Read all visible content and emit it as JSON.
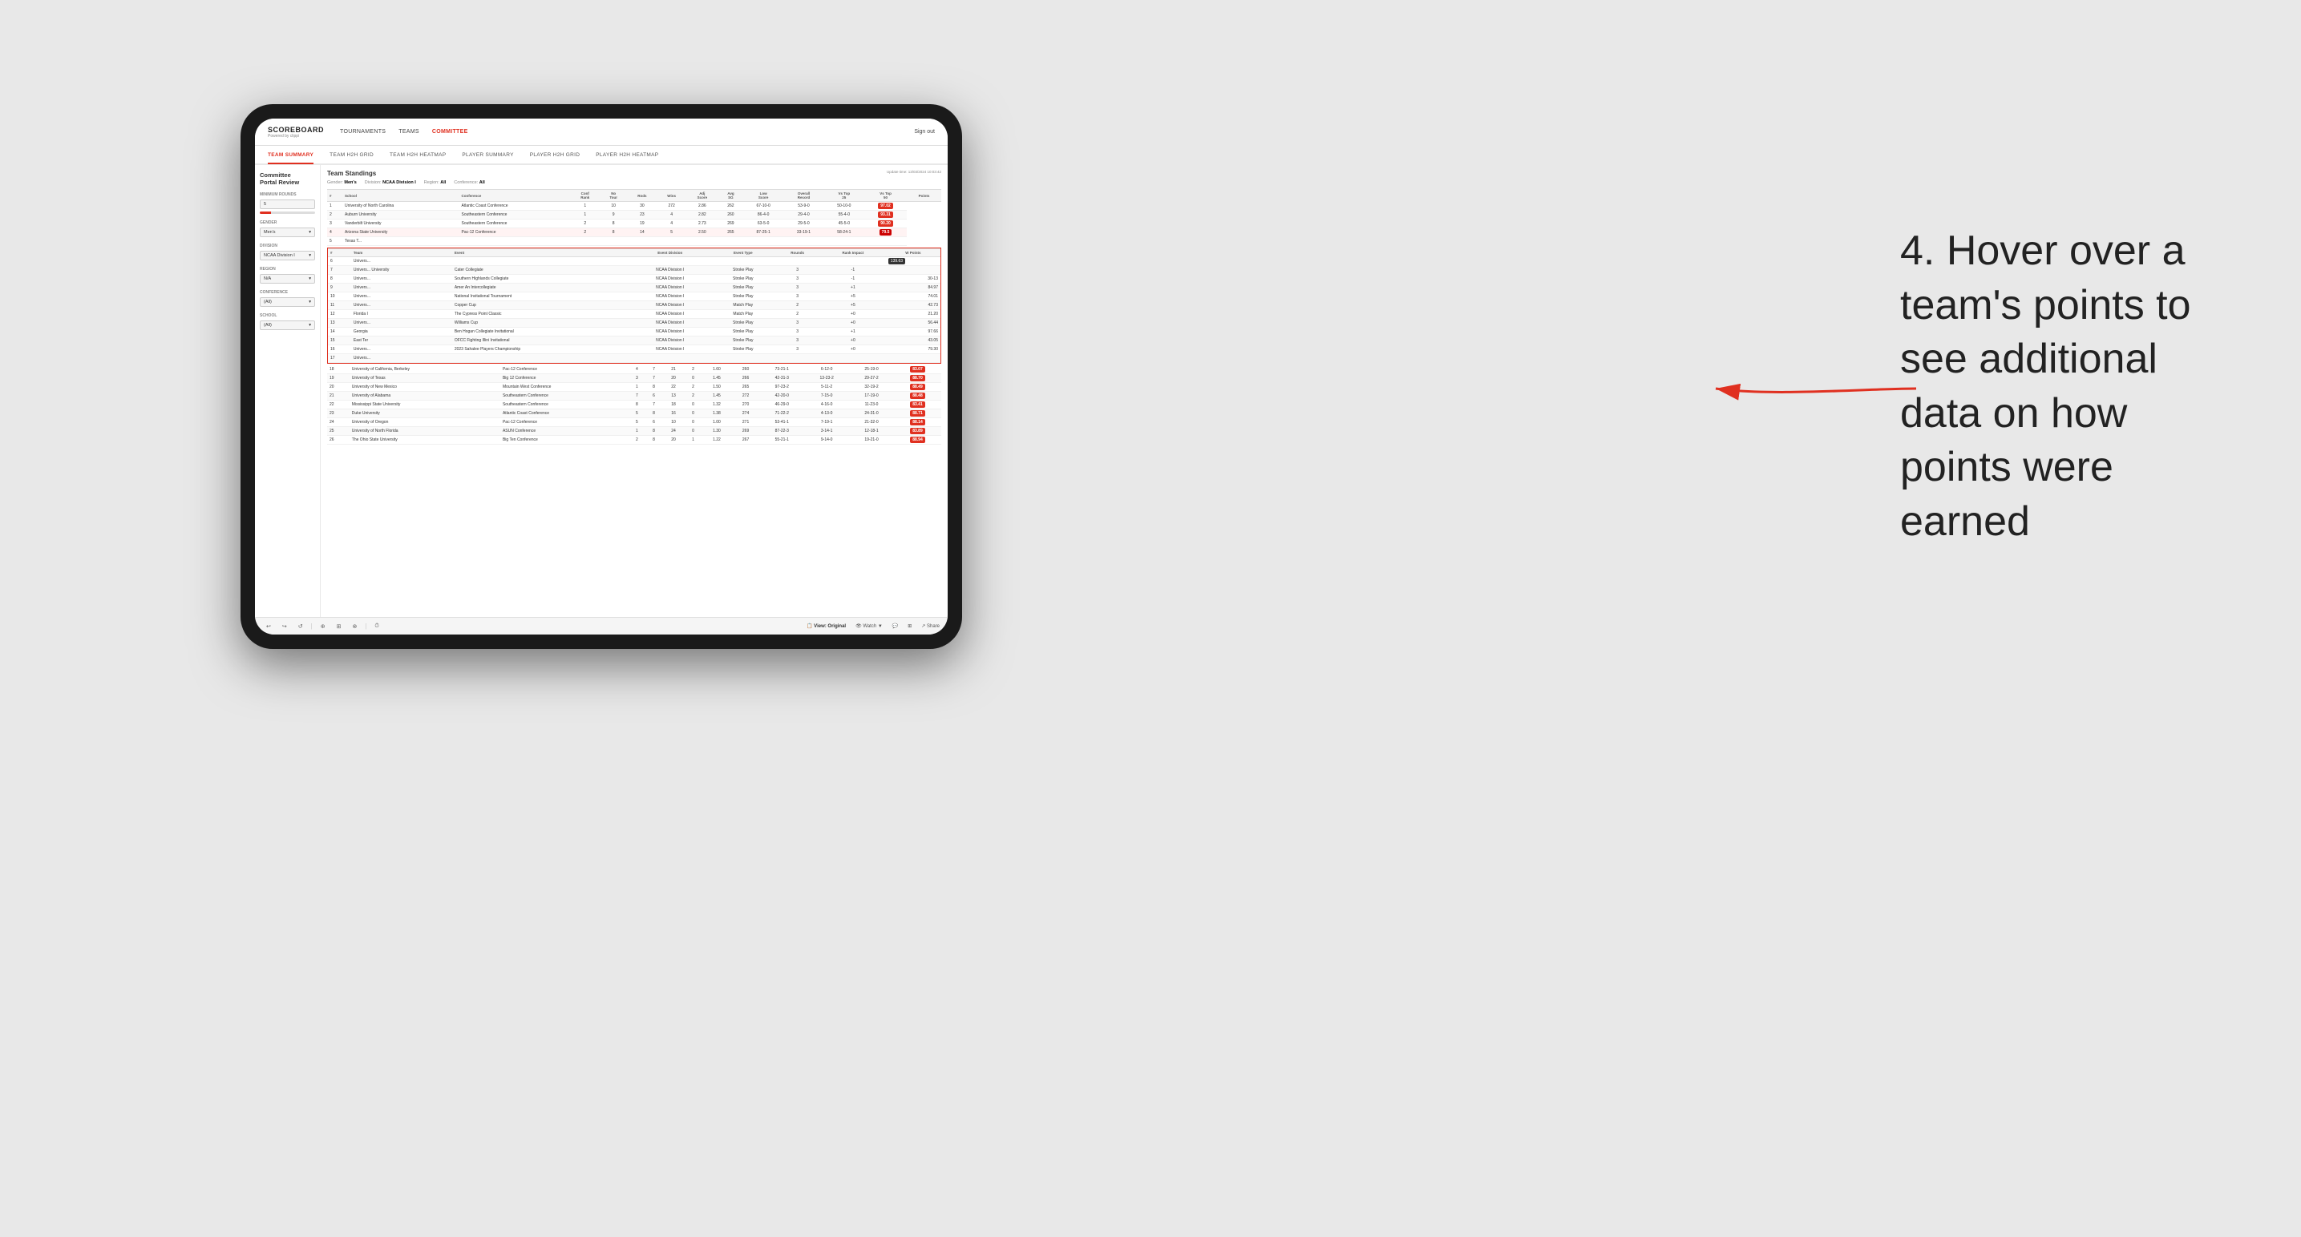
{
  "app": {
    "title": "SCOREBOARD",
    "subtitle": "Powered by clippi",
    "nav": {
      "items": [
        "TOURNAMENTS",
        "TEAMS",
        "COMMITTEE"
      ],
      "active": "COMMITTEE"
    },
    "sign_out": "Sign out",
    "sub_nav": {
      "items": [
        "TEAM SUMMARY",
        "TEAM H2H GRID",
        "TEAM H2H HEATMAP",
        "PLAYER SUMMARY",
        "PLAYER H2H GRID",
        "PLAYER H2H HEATMAP"
      ],
      "active": "TEAM SUMMARY"
    }
  },
  "sidebar": {
    "portal_title": "Committee\nPortal Review",
    "sections": [
      {
        "label": "Minimum Rounds",
        "value": "5",
        "has_slider": true
      },
      {
        "label": "Gender",
        "value": "Men's"
      },
      {
        "label": "Division",
        "value": "NCAA Division I"
      },
      {
        "label": "Region",
        "value": "N/A"
      },
      {
        "label": "Conference",
        "value": "(All)"
      },
      {
        "label": "School",
        "value": "(All)"
      }
    ]
  },
  "report": {
    "title": "Team Standings",
    "update_time": "Update time: 13/03/2024 10:03:42",
    "filters": {
      "gender_label": "Gender:",
      "gender_value": "Men's",
      "division_label": "Division:",
      "division_value": "NCAA Division I",
      "region_label": "Region:",
      "region_value": "All",
      "conference_label": "Conference:",
      "conference_value": "All"
    },
    "table_headers": [
      "#",
      "School",
      "Conference",
      "Conf Rank",
      "No Tour",
      "Rnds",
      "Wins",
      "Adj Score",
      "Avg SG",
      "Low Score",
      "Overall Record",
      "Vs Top 25",
      "Vs Top 50",
      "Points"
    ],
    "rows": [
      {
        "rank": 1,
        "school": "University of North Carolina",
        "conference": "Atlantic Coast Conference",
        "conf_rank": 1,
        "no_tour": 10,
        "rnds": 30,
        "wins": 272,
        "adj_score": 2.86,
        "avg_sg": 262,
        "low_score": "67-10-0",
        "overall": "53-9-0",
        "vs25": "50-10-0",
        "vs50": "97.02",
        "points": "97.02",
        "highlight": false
      },
      {
        "rank": 2,
        "school": "Auburn University",
        "conference": "Southeastern Conference",
        "conf_rank": 1,
        "no_tour": 9,
        "rnds": 23,
        "wins": 4,
        "adj_score": 2.82,
        "avg_sg": 260,
        "low_score": "86-4-0",
        "overall": "29-4-0",
        "vs25": "55-4-0",
        "vs50": "93.31",
        "points": "93.31",
        "highlight": false
      },
      {
        "rank": 3,
        "school": "Vanderbilt University",
        "conference": "Southeastern Conference",
        "conf_rank": 2,
        "no_tour": 8,
        "rnds": 19,
        "wins": 4,
        "adj_score": 2.73,
        "avg_sg": 269,
        "low_score": "63-5-0",
        "overall": "29-5-0",
        "vs25": "45-5-0",
        "vs50": "90.20",
        "points": "90.20",
        "highlight": false
      },
      {
        "rank": 4,
        "school": "Arizona State University",
        "conference": "Pac-12 Conference",
        "conf_rank": 2,
        "no_tour": 8,
        "rnds": 14,
        "wins": 5,
        "adj_score": 2.5,
        "avg_sg": 265,
        "low_score": "87-25-1",
        "overall": "33-19-1",
        "vs25": "58-24-1",
        "vs50": "79.5",
        "points": "79.5",
        "highlight": true
      },
      {
        "rank": 5,
        "school": "Texas T...",
        "conference": "",
        "conf_rank": "",
        "no_tour": "",
        "rnds": "",
        "wins": "",
        "adj_score": "",
        "avg_sg": "",
        "low_score": "",
        "overall": "",
        "vs25": "",
        "vs50": "",
        "points": "",
        "highlight": false
      }
    ],
    "popup": {
      "headers": [
        "#",
        "Team",
        "Event",
        "Event Division",
        "Event Type",
        "Rounds",
        "Rank Impact",
        "W Points"
      ],
      "rows": [
        {
          "rank": 6,
          "team": "Univers...",
          "event": "",
          "event_div": "",
          "event_type": "",
          "rounds": "",
          "rank_impact": "",
          "w_points": ""
        },
        {
          "rank": 7,
          "team": "Univers...",
          "event": "Cater Collegiate",
          "event_div": "NCAA Division I",
          "event_type": "Stroke Play",
          "rounds": 3,
          "rank_impact": -1,
          "w_points": ""
        },
        {
          "rank": 8,
          "team": "Univers...",
          "event": "Southern Highlands Collegiate",
          "event_div": "NCAA Division I",
          "event_type": "Stroke Play",
          "rounds": 3,
          "rank_impact": -1,
          "w_points": "30-13"
        },
        {
          "rank": 9,
          "team": "Univers...",
          "event": "Amer An Intercollegiate",
          "event_div": "NCAA Division I",
          "event_type": "Stroke Play",
          "rounds": 3,
          "rank_impact": "+1",
          "w_points": "84.97"
        },
        {
          "rank": 10,
          "team": "Univers...",
          "event": "National Invitational Tournament",
          "event_div": "NCAA Division I",
          "event_type": "Stroke Play",
          "rounds": 3,
          "rank_impact": "+5",
          "w_points": "74.01"
        },
        {
          "rank": 11,
          "team": "Univers...",
          "event": "Copper Cup",
          "event_div": "NCAA Division I",
          "event_type": "Match Play",
          "rounds": 2,
          "rank_impact": "+5",
          "w_points": "42.73"
        },
        {
          "rank": 12,
          "team": "Florida I",
          "event": "The Cypress Point Classic",
          "event_div": "NCAA Division I",
          "event_type": "Match Play",
          "rounds": 2,
          "rank_impact": "+0",
          "w_points": "21.20"
        },
        {
          "rank": 13,
          "team": "Univers...",
          "event": "Williams Cup",
          "event_div": "NCAA Division I",
          "event_type": "Stroke Play",
          "rounds": 3,
          "rank_impact": "+0",
          "w_points": "56.44"
        },
        {
          "rank": 14,
          "team": "Georgia",
          "event": "Ben Hogan Collegiate Invitational",
          "event_div": "NCAA Division I",
          "event_type": "Stroke Play",
          "rounds": 3,
          "rank_impact": "+1",
          "w_points": "97.66"
        },
        {
          "rank": 15,
          "team": "East Ter",
          "event": "OFCC Fighting Illini Invitational",
          "event_div": "NCAA Division I",
          "event_type": "Stroke Play",
          "rounds": 3,
          "rank_impact": "+0",
          "w_points": "43.05"
        },
        {
          "rank": 16,
          "team": "Univers...",
          "event": "2023 Sahalee Players Championship",
          "event_div": "NCAA Division I",
          "event_type": "Stroke Play",
          "rounds": 3,
          "rank_impact": "+0",
          "w_points": "79.30"
        },
        {
          "rank": 17,
          "team": "Univers...",
          "event": "",
          "event_div": "",
          "event_type": "",
          "rounds": "",
          "rank_impact": "",
          "w_points": ""
        }
      ]
    },
    "lower_rows": [
      {
        "rank": 18,
        "school": "University of California, Berkeley",
        "conference": "Pac-12 Conference",
        "conf_rank": 4,
        "no_tour": 7,
        "rnds": 21,
        "wins": 2,
        "adj_score": 1.6,
        "avg_sg": 260,
        "low_score": "73-21-1",
        "overall": "6-12-0",
        "vs25": "25-19-0",
        "vs50": "83.07",
        "points": "83.07"
      },
      {
        "rank": 19,
        "school": "University of Texas",
        "conference": "Big 12 Conference",
        "conf_rank": 3,
        "no_tour": 7,
        "rnds": 20,
        "wins": 0,
        "adj_score": 1.45,
        "avg_sg": 266,
        "low_score": "42-31-3",
        "overall": "13-23-2",
        "vs25": "29-27-2",
        "vs50": "88.70",
        "points": "88.70"
      },
      {
        "rank": 20,
        "school": "University of New Mexico",
        "conference": "Mountain West Conference",
        "conf_rank": 1,
        "no_tour": 8,
        "rnds": 22,
        "wins": 2,
        "adj_score": 1.5,
        "avg_sg": 265,
        "low_score": "97-23-2",
        "overall": "5-11-2",
        "vs25": "32-19-2",
        "vs50": "88.49",
        "points": "88.49"
      },
      {
        "rank": 21,
        "school": "University of Alabama",
        "conference": "Southeastern Conference",
        "conf_rank": 7,
        "no_tour": 6,
        "rnds": 13,
        "wins": 2,
        "adj_score": 1.45,
        "avg_sg": 272,
        "low_score": "42-20-0",
        "overall": "7-15-0",
        "vs25": "17-19-0",
        "vs50": "88.48",
        "points": "88.48"
      },
      {
        "rank": 22,
        "school": "Mississippi State University",
        "conference": "Southeastern Conference",
        "conf_rank": 8,
        "no_tour": 7,
        "rnds": 18,
        "wins": 0,
        "adj_score": 1.32,
        "avg_sg": 270,
        "low_score": "46-29-0",
        "overall": "4-16-0",
        "vs25": "11-23-0",
        "vs50": "83.41",
        "points": "83.41"
      },
      {
        "rank": 23,
        "school": "Duke University",
        "conference": "Atlantic Coast Conference",
        "conf_rank": 5,
        "no_tour": 8,
        "rnds": 16,
        "wins": 0,
        "adj_score": 1.38,
        "avg_sg": 274,
        "low_score": "71-22-2",
        "overall": "4-13-0",
        "vs25": "24-31-0",
        "vs50": "88.71",
        "points": "88.71"
      },
      {
        "rank": 24,
        "school": "University of Oregon",
        "conference": "Pac-12 Conference",
        "conf_rank": 5,
        "no_tour": 6,
        "rnds": 10,
        "wins": 0,
        "adj_score": 1.0,
        "avg_sg": 271,
        "low_score": "53-41-1",
        "overall": "7-19-1",
        "vs25": "21-32-0",
        "vs50": "88.14",
        "points": "88.14"
      },
      {
        "rank": 25,
        "school": "University of North Florida",
        "conference": "ASUN Conference",
        "conf_rank": 1,
        "no_tour": 8,
        "rnds": 24,
        "wins": 0,
        "adj_score": 1.3,
        "avg_sg": 269,
        "low_score": "87-22-3",
        "overall": "3-14-1",
        "vs25": "12-18-1",
        "vs50": "83.89",
        "points": "83.89"
      },
      {
        "rank": 26,
        "school": "The Ohio State University",
        "conference": "Big Ten Conference",
        "conf_rank": 2,
        "no_tour": 8,
        "rnds": 20,
        "wins": 1,
        "adj_score": 1.22,
        "avg_sg": 267,
        "low_score": "55-21-1",
        "overall": "9-14-0",
        "vs25": "19-21-0",
        "vs50": "88.94",
        "points": "88.94"
      }
    ]
  },
  "toolbar": {
    "undo_label": "↩",
    "redo_label": "↪",
    "reset_label": "↺",
    "zoom_in": "+",
    "zoom_out": "-",
    "view_label": "📋 View: Original",
    "watch_label": "👁 Watch ▼",
    "comment_label": "💬",
    "layout_label": "⊞",
    "share_label": "↗ Share"
  },
  "annotation": {
    "text": "4. Hover over a team's points to see additional data on how points were earned"
  }
}
